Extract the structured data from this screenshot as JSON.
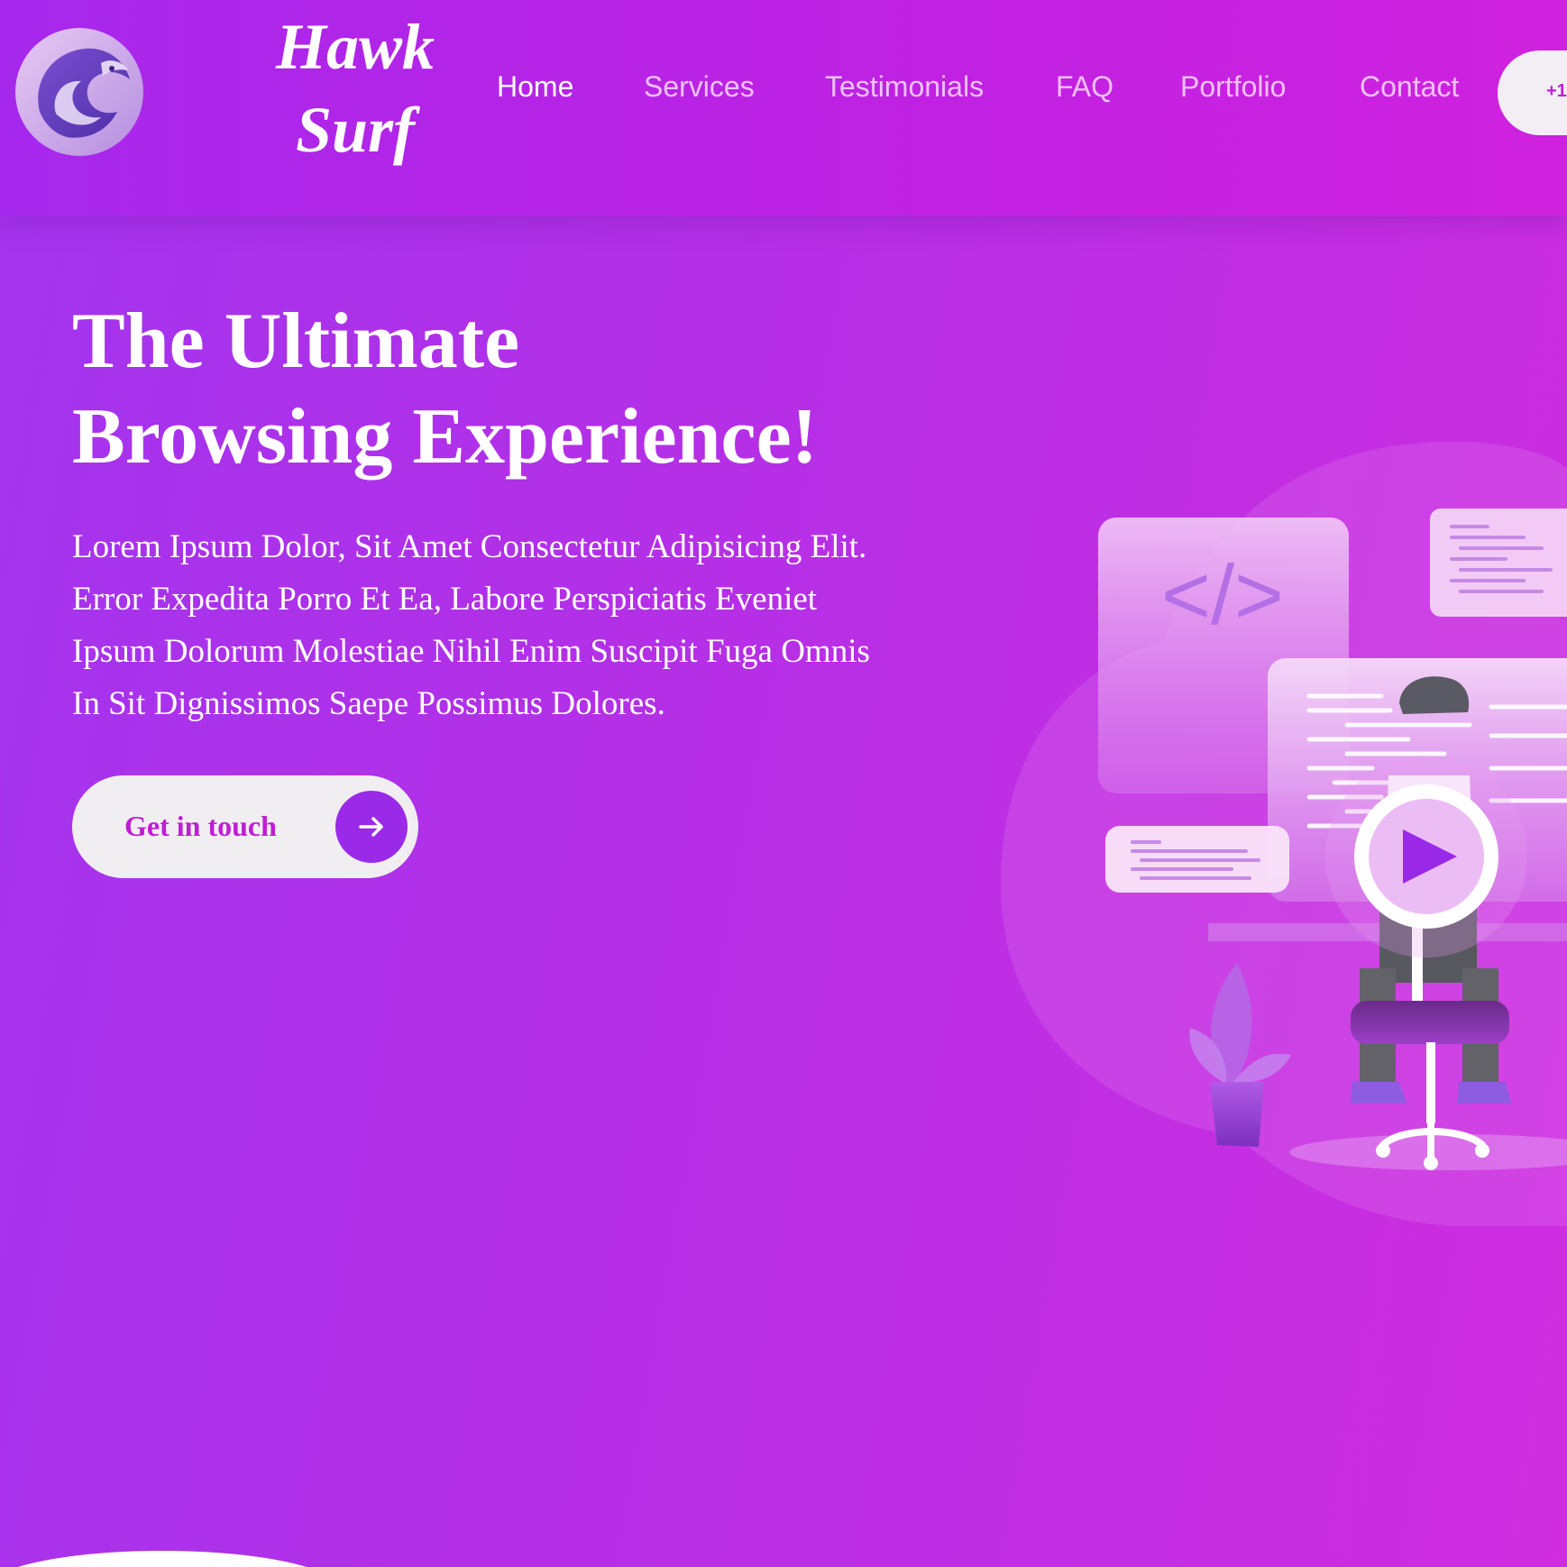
{
  "brand": {
    "line1": "Hawk",
    "line2": "Surf"
  },
  "nav": {
    "items": [
      {
        "label": "Home",
        "active": true
      },
      {
        "label": "Services",
        "active": false
      },
      {
        "label": "Testimonials",
        "active": false
      },
      {
        "label": "FAQ",
        "active": false
      },
      {
        "label": "Portfolio",
        "active": false
      },
      {
        "label": "Contact",
        "active": false
      }
    ],
    "phone_label": "+1"
  },
  "hero": {
    "title_line1": "The Ultimate",
    "title_line2": "Browsing Experience!",
    "description": "Lorem Ipsum Dolor, Sit Amet Consectetur Adipisicing Elit. Error Expedita Porro Et Ea, Labore Perspiciatis Eveniet Ipsum Dolorum Molestiae Nihil Enim Suscipit Fuga Omnis In Sit Dignissimos Saepe Possimus Dolores.",
    "cta_label": "Get in touch",
    "code_symbol": "</>"
  },
  "icons": {
    "logo": "hawk-logo-icon",
    "cta_arrow": "arrow-right-icon",
    "play": "play-icon"
  },
  "colors": {
    "background_start": "#a334ee",
    "background_end": "#cf2ddf",
    "accent_magenta": "#bf1ed5",
    "accent_purple": "#9a2ae8",
    "button_bg": "#f1eef2"
  }
}
